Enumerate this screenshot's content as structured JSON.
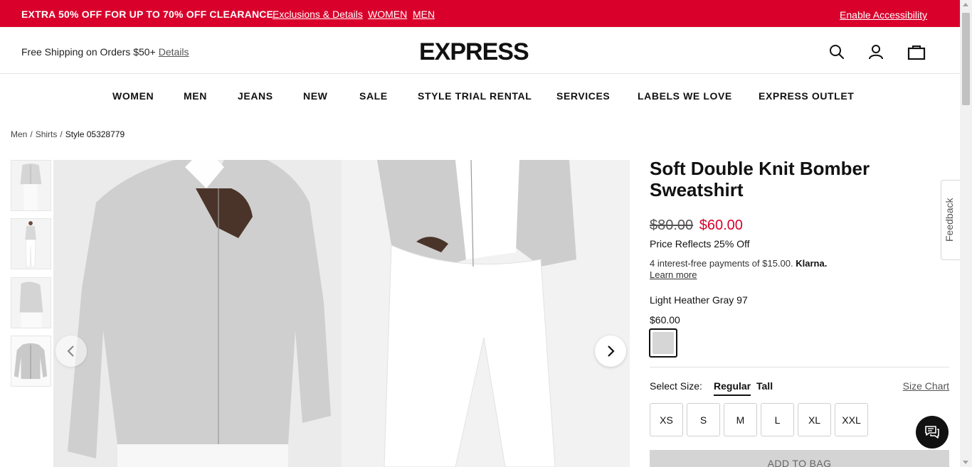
{
  "promo": {
    "headline": "EXTRA 50% OFF FOR UP TO 70% OFF CLEARANCE",
    "links": [
      "Exclusions & Details",
      "WOMEN",
      "MEN"
    ],
    "accessibility": "Enable Accessibility"
  },
  "header": {
    "shipping_text": "Free Shipping on Orders $50+",
    "shipping_link": "Details",
    "logo": "EXPRESS",
    "icons": [
      "search-icon",
      "account-icon",
      "bag-icon"
    ]
  },
  "nav": [
    "WOMEN",
    "MEN",
    "JEANS",
    "NEW",
    "SALE",
    "STYLE TRIAL RENTAL",
    "SERVICES",
    "LABELS WE LOVE",
    "EXPRESS OUTLET"
  ],
  "breadcrumb": [
    "Men",
    "Shirts",
    "Style 05328779"
  ],
  "product": {
    "title": "Soft Double Knit Bomber Sweatshirt",
    "original_price": "$80.00",
    "sale_price": "$60.00",
    "discount_note": "Price Reflects 25% Off",
    "klarna_text": "4 interest-free payments of $15.00.",
    "klarna_brand": "Klarna.",
    "klarna_link": "Learn more",
    "color_name": "Light Heather Gray 97",
    "color_price": "$60.00",
    "swatch_color": "#d6d6d6",
    "size_label": "Select Size:",
    "fit_tabs": [
      "Regular",
      "Tall"
    ],
    "size_chart": "Size Chart",
    "sizes": [
      "XS",
      "S",
      "M",
      "L",
      "XL",
      "XXL"
    ],
    "add_to_bag": "ADD TO BAG"
  },
  "feedback": "Feedback",
  "colors": {
    "brand_red": "#d9002b",
    "text": "#111111"
  }
}
